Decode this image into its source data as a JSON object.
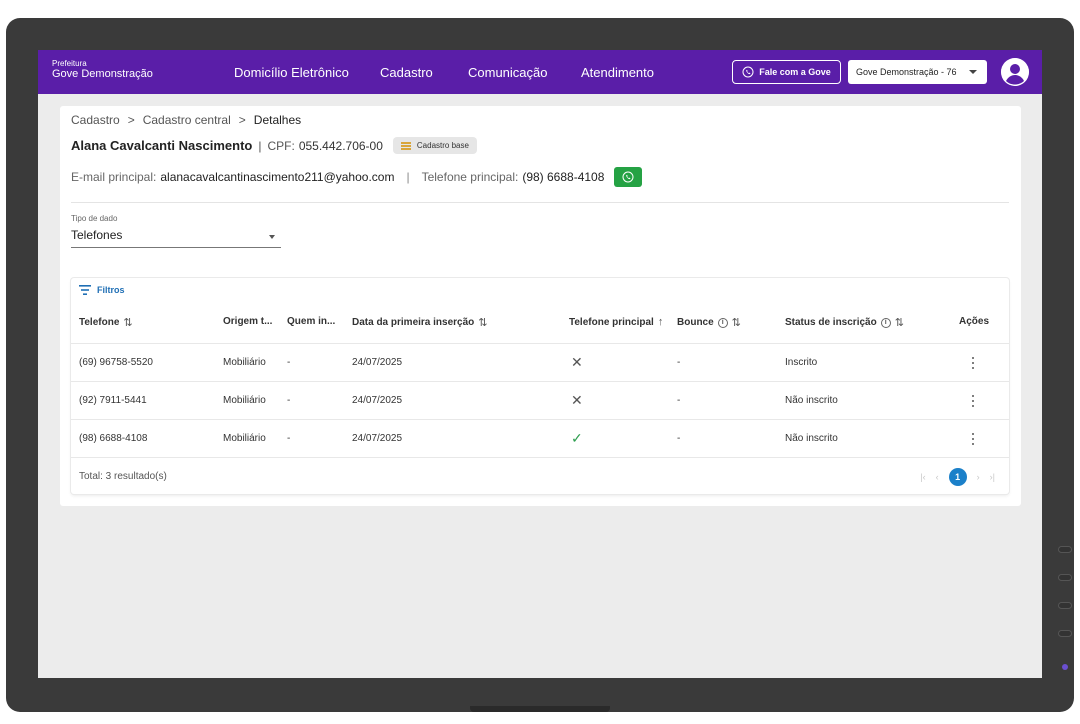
{
  "brand": {
    "small": "Prefeitura",
    "name": "Gove Demonstração"
  },
  "nav": [
    "Domicílio Eletrônico",
    "Cadastro",
    "Comunicação",
    "Atendimento"
  ],
  "fale_button": "Fale com a Gove",
  "org_select": "Gove Demonstração - 76",
  "breadcrumb": {
    "items": [
      "Cadastro",
      "Cadastro central",
      "Detalhes"
    ],
    "separator": ">"
  },
  "person": {
    "name": "Alana Cavalcanti Nascimento",
    "separator": "|",
    "cpf_label": "CPF:",
    "cpf": "055.442.706-00",
    "badge": "Cadastro base"
  },
  "contact": {
    "email_label": "E-mail principal:",
    "email": "alanacavalcantinascimento211@yahoo.com",
    "divider": "|",
    "phone_label": "Telefone principal:",
    "phone": "(98) 6688-4108"
  },
  "tipo": {
    "label": "Tipo de dado",
    "value": "Telefones"
  },
  "filtros": "Filtros",
  "table": {
    "headers": {
      "telefone": "Telefone",
      "origem": "Origem t...",
      "quem": "Quem in...",
      "data": "Data da primeira inserção",
      "principal": "Telefone principal",
      "bounce": "Bounce",
      "status": "Status de inscrição",
      "acoes": "Ações"
    },
    "sort_both": "⇅",
    "sort_up": "↑",
    "info_glyph": "i",
    "rows": [
      {
        "telefone": "(69) 96758-5520",
        "origem": "Mobiliário",
        "quem": "-",
        "data": "24/07/2025",
        "principal": "✕",
        "bounce": "-",
        "status": "Inscrito"
      },
      {
        "telefone": "(92) 7911-5441",
        "origem": "Mobiliário",
        "quem": "-",
        "data": "24/07/2025",
        "principal": "✕",
        "bounce": "-",
        "status": "Não inscrito"
      },
      {
        "telefone": "(98) 6688-4108",
        "origem": "Mobiliário",
        "quem": "-",
        "data": "24/07/2025",
        "principal": "✓",
        "bounce": "-",
        "status": "Não inscrito"
      }
    ],
    "total": "Total: 3 resultado(s)"
  },
  "pager": {
    "first": "|‹",
    "prev": "‹",
    "current": "1",
    "next": "›",
    "last": "›|"
  },
  "colors": {
    "nav_purple": "#5a1ea8",
    "whatsapp_green": "#25a244",
    "link_blue": "#1f6fb5",
    "page_blue": "#1b80c9",
    "check_green": "#2e9e4f"
  }
}
